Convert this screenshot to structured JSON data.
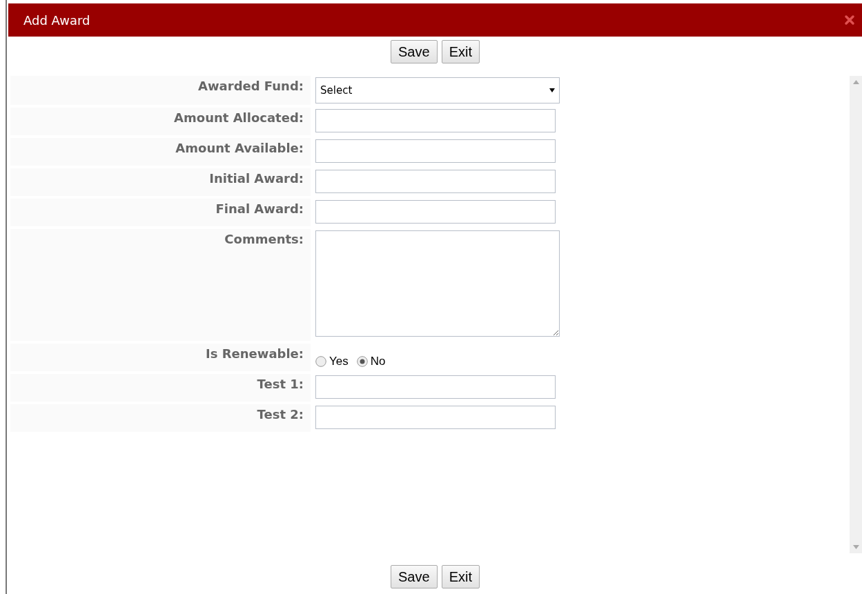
{
  "dialog": {
    "title": "Add Award"
  },
  "top_buttons": [
    "Save",
    "Exit"
  ],
  "fields": [
    {
      "label": "Awarded Fund:",
      "kind": "select",
      "value": "Select"
    },
    {
      "label": "Amount Allocated:",
      "kind": "text"
    },
    {
      "label": "Amount Available:",
      "kind": "text"
    },
    {
      "label": "Initial Award:",
      "kind": "text"
    },
    {
      "label": "Final Award:",
      "kind": "text"
    },
    {
      "label": "Comments:",
      "kind": "textarea"
    },
    {
      "label": "Is Renewable:",
      "kind": "radio",
      "options": [
        {
          "label": "Yes",
          "selected": false
        },
        {
          "label": "No",
          "selected": true
        }
      ]
    },
    {
      "label": "Test 1:",
      "kind": "text"
    },
    {
      "label": "Test 2:",
      "kind": "text"
    }
  ],
  "bottom_buttons": [
    "Save",
    "Exit"
  ]
}
